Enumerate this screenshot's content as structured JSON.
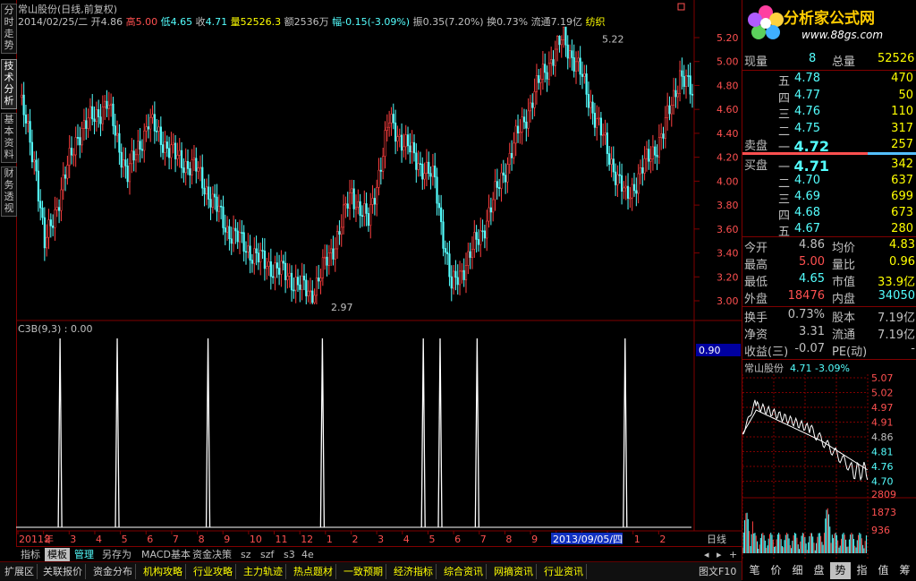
{
  "title": {
    "stock": "常山股份",
    "mode": "(日线,前复权)"
  },
  "bar_info": {
    "date": "2014/02/25/二",
    "open_label": "开",
    "open": "4.86",
    "high_label": "高",
    "high": "5.00",
    "low_label": "低",
    "low": "4.65",
    "close_label": "收",
    "close": "4.71",
    "vol_label": "量",
    "vol": "52526.3",
    "amt_label": "额",
    "amt": "2536万",
    "chg_label": "幅",
    "chg": "-0.15(-3.09%)",
    "amp_label": "振",
    "amp": "0.35(7.20%)",
    "turn_label": "换",
    "turn": "0.73%",
    "float_label": "流通",
    "float": "7.19亿",
    "industry": "纺织"
  },
  "vtabs": [
    "分时走势",
    "技术分析",
    "基本资料",
    "财务透视"
  ],
  "price_axis": [
    "5.20",
    "5.00",
    "4.80",
    "4.60",
    "4.40",
    "4.20",
    "4.00",
    "3.80",
    "3.60",
    "3.40",
    "3.20",
    "3.00"
  ],
  "markers": {
    "high": "5.22",
    "low": "2.97"
  },
  "indicator": {
    "title": "C3B(9,3) : 0.00",
    "value_box": "0.90"
  },
  "x_axis": {
    "labels": [
      "2011年",
      "2",
      "3",
      "4",
      "5",
      "6",
      "7",
      "8",
      "9",
      "10",
      "11",
      "12",
      "1",
      "2",
      "3",
      "4",
      "5",
      "6",
      "7",
      "8",
      "9",
      "10",
      "11",
      "12",
      "1",
      "2"
    ],
    "highlight": "2013/09/05/四",
    "period": "日线"
  },
  "chart_data": {
    "type": "candlestick",
    "title": "常山股份(日线,前复权)",
    "ylim": [
      2.95,
      5.25
    ],
    "high": 5.22,
    "low": 2.97,
    "indicator_spikes_x_fraction": [
      0.06,
      0.145,
      0.28,
      0.45,
      0.6,
      0.625,
      0.68,
      0.9
    ]
  },
  "quote": {
    "now_label": "现量",
    "now": "8",
    "total_label": "总量",
    "total": "52526",
    "sell": [
      {
        "lvl": "五",
        "price": "4.78",
        "vol": "470"
      },
      {
        "lvl": "四",
        "price": "4.77",
        "vol": "50"
      },
      {
        "lvl": "三",
        "price": "4.76",
        "vol": "110"
      },
      {
        "lvl": "二",
        "price": "4.75",
        "vol": "317"
      },
      {
        "lvl": "一",
        "price": "4.72",
        "vol": "257"
      }
    ],
    "sell_label": "卖盘",
    "buy_label": "买盘",
    "buy": [
      {
        "lvl": "一",
        "price": "4.71",
        "vol": "342"
      },
      {
        "lvl": "二",
        "price": "4.70",
        "vol": "637"
      },
      {
        "lvl": "三",
        "price": "4.69",
        "vol": "699"
      },
      {
        "lvl": "四",
        "price": "4.68",
        "vol": "673"
      },
      {
        "lvl": "五",
        "price": "4.67",
        "vol": "280"
      }
    ],
    "stats": [
      {
        "l1": "今开",
        "v1": "4.86",
        "l2": "均价",
        "v2": "4.83"
      },
      {
        "l1": "最高",
        "v1": "5.00",
        "l2": "量比",
        "v2": "0.96"
      },
      {
        "l1": "最低",
        "v1": "4.65",
        "l2": "市值",
        "v2": "33.9亿"
      },
      {
        "l1": "外盘",
        "v1": "18476",
        "l2": "内盘",
        "v2": "34050"
      }
    ],
    "fin": [
      {
        "l1": "换手",
        "v1": "0.73%",
        "l2": "股本",
        "v2": "7.19亿"
      },
      {
        "l1": "净资",
        "v1": "3.31",
        "l2": "流通",
        "v2": "7.19亿"
      },
      {
        "l1": "收益(三)",
        "v1": "-0.07",
        "l2": "PE(动)",
        "v2": "-"
      }
    ]
  },
  "mini": {
    "title": "常山股份",
    "price": "4.71",
    "pct": "-3.09%",
    "axis": [
      "5.07",
      "5.02",
      "4.97",
      "4.91",
      "4.86",
      "4.81",
      "4.76",
      "4.70"
    ],
    "vol_axis": [
      "2809",
      "1873",
      "936"
    ]
  },
  "logo": {
    "text": "分析家公式网",
    "url": "www.88gs.com"
  },
  "tabs1": [
    "指标",
    "模板",
    "管理",
    "另存为",
    "MACD基本",
    "资金决策",
    "sz",
    "szf",
    "s3",
    "4e"
  ],
  "tabs2": [
    "扩展区",
    "关联报价",
    "资金分布",
    "机构攻略",
    "行业攻略",
    "主力轨迹",
    "热点题材",
    "一致预期",
    "经济指标",
    "综合资讯",
    "网摘资讯",
    "行业资讯"
  ],
  "right_tab_label": "图文F10",
  "right_tabs": [
    "笔",
    "价",
    "细",
    "盘",
    "势",
    "指",
    "值",
    "筹"
  ]
}
